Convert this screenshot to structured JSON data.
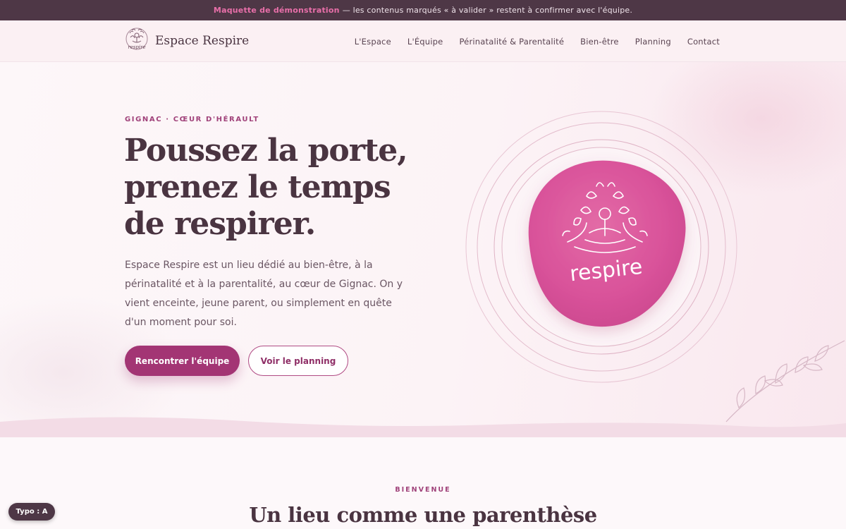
{
  "banner": {
    "highlight": "Maquette de démonstration",
    "text": "— les contenus marqués « à valider » restent à confirmer avec l'équipe."
  },
  "header": {
    "brand_name": "Espace Respire",
    "logo_text": "respire",
    "nav": [
      "L'Espace",
      "L'Équipe",
      "Périnatalité & Parentalité",
      "Bien-être",
      "Planning",
      "Contact"
    ]
  },
  "hero": {
    "eyebrow": "GIGNAC · CŒUR D'HÉRAULT",
    "title": "Poussez la porte, prenez le temps de respirer.",
    "text": "Espace Respire est un lieu dédié au bien-être, à la périnatalité et à la parentalité, au cœur de Gignac. On y vient enceinte, jeune parent, ou simplement en quête d'un moment pour soi.",
    "cta_primary": "Rencontrer l'équipe",
    "cta_secondary": "Voir le planning",
    "logo_text": "respire"
  },
  "welcome": {
    "eyebrow": "BIENVENUE",
    "title": "Un lieu comme une parenthèse"
  },
  "typo_badge": "Typo : A",
  "colors": {
    "banner_bg": "#4e3746",
    "accent": "#a33574",
    "accent_light": "#e86fa9",
    "text_dark": "#4a3441",
    "logo_pink": "#d94d93"
  }
}
